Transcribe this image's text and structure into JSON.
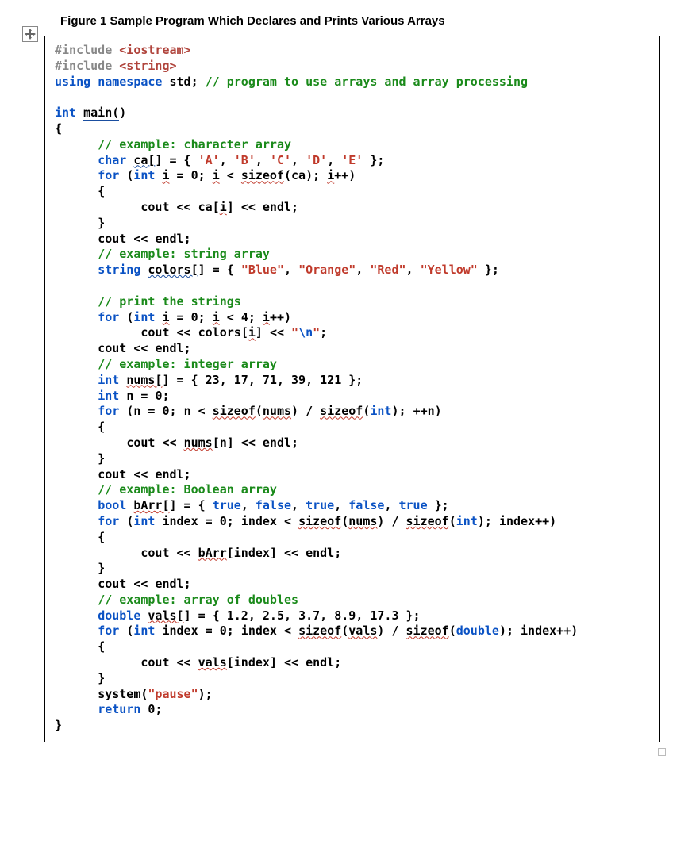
{
  "caption": "Figure 1 Sample Program Which Declares and Prints Various Arrays",
  "code": {
    "pp_inc": "#include",
    "hdr_iostream": "<iostream>",
    "hdr_string": "<string>",
    "kw_using": "using",
    "kw_namespace": "namespace",
    "std": "std",
    "cm_program": "// program to use arrays and array processing",
    "kw_int": "int",
    "main": "main(",
    "main_close": ")",
    "lbrace": "{",
    "rbrace": "}",
    "cm_char": "// example: character array",
    "kw_char": "char",
    "ca": "ca[",
    "ca_close": "]",
    "eq_open": " = { ",
    "chars": {
      "A": "'A'",
      "B": "'B'",
      "C": "'C'",
      "D": "'D'",
      "E": "'E'"
    },
    "close_braces": " };",
    "kw_for": "for",
    "i": "i",
    "zero": "0",
    "lt": "<",
    "sizeof": "sizeof",
    "sizeof_open": "(",
    "ca_plain": "ca",
    "ipp": "i",
    "ipp_suffix": "++",
    "cout": "cout",
    "llt": "<<",
    "endl": "endl",
    "semi": ";",
    "cm_string": "// example: string array",
    "kw_string": "string",
    "colors": "colors[",
    "colors_close": "]",
    "str_blue": "\"Blue\"",
    "str_orange": "\"Orange\"",
    "str_red": "\"Red\"",
    "str_yellow": "\"Yellow\"",
    "cm_print": "// print the strings",
    "four": "4",
    "colors_plain": "colors",
    "nl": "\"",
    "nl_esc": "\\n",
    "nl_close": "\"",
    "cm_int": "// example: integer array",
    "nums": "nums[",
    "nums_close": "]",
    "n23": "23",
    "n17": "17",
    "n71": "71",
    "n39": "39",
    "n121": "121",
    "n": "n",
    "nums_plain": "nums",
    "div": " / ",
    "sizeof_int": "int",
    "ppn": "++n",
    "cm_bool": "// example: Boolean array",
    "kw_bool": "bool",
    "bArr": "bArr[",
    "bArr_close": "]",
    "true": "true",
    "false": "false",
    "index": "index",
    "bArr_plain": "bArr",
    "cm_dbl": "// example: array of doubles",
    "kw_double": "double",
    "vals": "vals[",
    "vals_close": "]",
    "d1": "1.2",
    "d2": "2.5",
    "d3": "3.7",
    "d4": "8.9",
    "d5": "17.3",
    "vals_plain": "vals",
    "sizeof_double": "double",
    "system": "system",
    "pause": "\"pause\"",
    "kw_return": "return"
  }
}
